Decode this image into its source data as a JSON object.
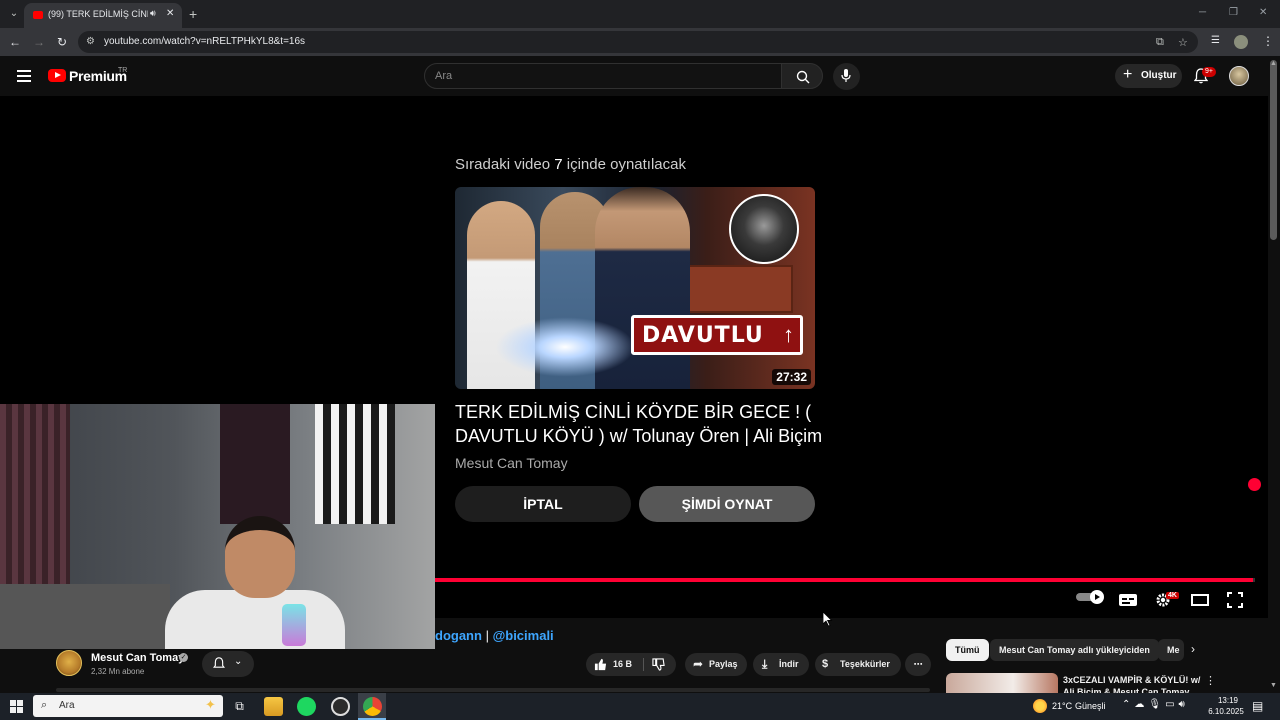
{
  "browser": {
    "tab_title": "(99) TERK EDİLMİŞ CİNLİ KÖ",
    "url": "youtube.com/watch?v=nRELTPHkYL8&t=16s"
  },
  "youtube": {
    "logo_text": "Premium",
    "country_code": "TR",
    "search_placeholder": "Ara",
    "create_label": "Oluştur",
    "notifications_badge": "9+"
  },
  "player": {
    "upnext_prefix": "Sıradaki video ",
    "upnext_seconds": "7",
    "upnext_suffix": " içinde oynatılacak",
    "next_video": {
      "title": "TERK EDİLMİŞ CİNLİ KÖYDE BİR GECE ! ( DAVUTLU KÖYÜ ) w/ Tolunay Ören | Ali Biçim",
      "channel": "Mesut Can Tomay",
      "duration": "27:32",
      "thumbnail_sign": "DAVUTLU"
    },
    "cancel_label": "İPTAL",
    "play_now_label": "ŞİMDİ OYNAT",
    "progress_fraction": 0.997,
    "quality_badge": "4K"
  },
  "video_info": {
    "desc_link_1": "dogann",
    "desc_separator": "|",
    "desc_link_2": "@bicimali",
    "channel_name": "Mesut Can Tomay",
    "subscribers": "2,32 Mn abone",
    "likes": "16 B",
    "share_label": "Paylaş",
    "download_label": "İndir",
    "thanks_label": "Teşekkürler"
  },
  "recommendations": {
    "chips": [
      "Tümü",
      "Mesut Can Tomay adlı yükleyiciden",
      "Me"
    ],
    "first_title": "3xCEZALI VAMPİR & KÖYLÜ! w/ Ali Biçim & Mesut Can Tomay"
  },
  "taskbar": {
    "search_text": "Ara",
    "temperature": "21°C",
    "condition": "Güneşli",
    "time": "13:19",
    "date": "6.10.2025"
  },
  "colors": {
    "accent_red": "#ff0033",
    "link_blue": "#3ea6ff"
  }
}
